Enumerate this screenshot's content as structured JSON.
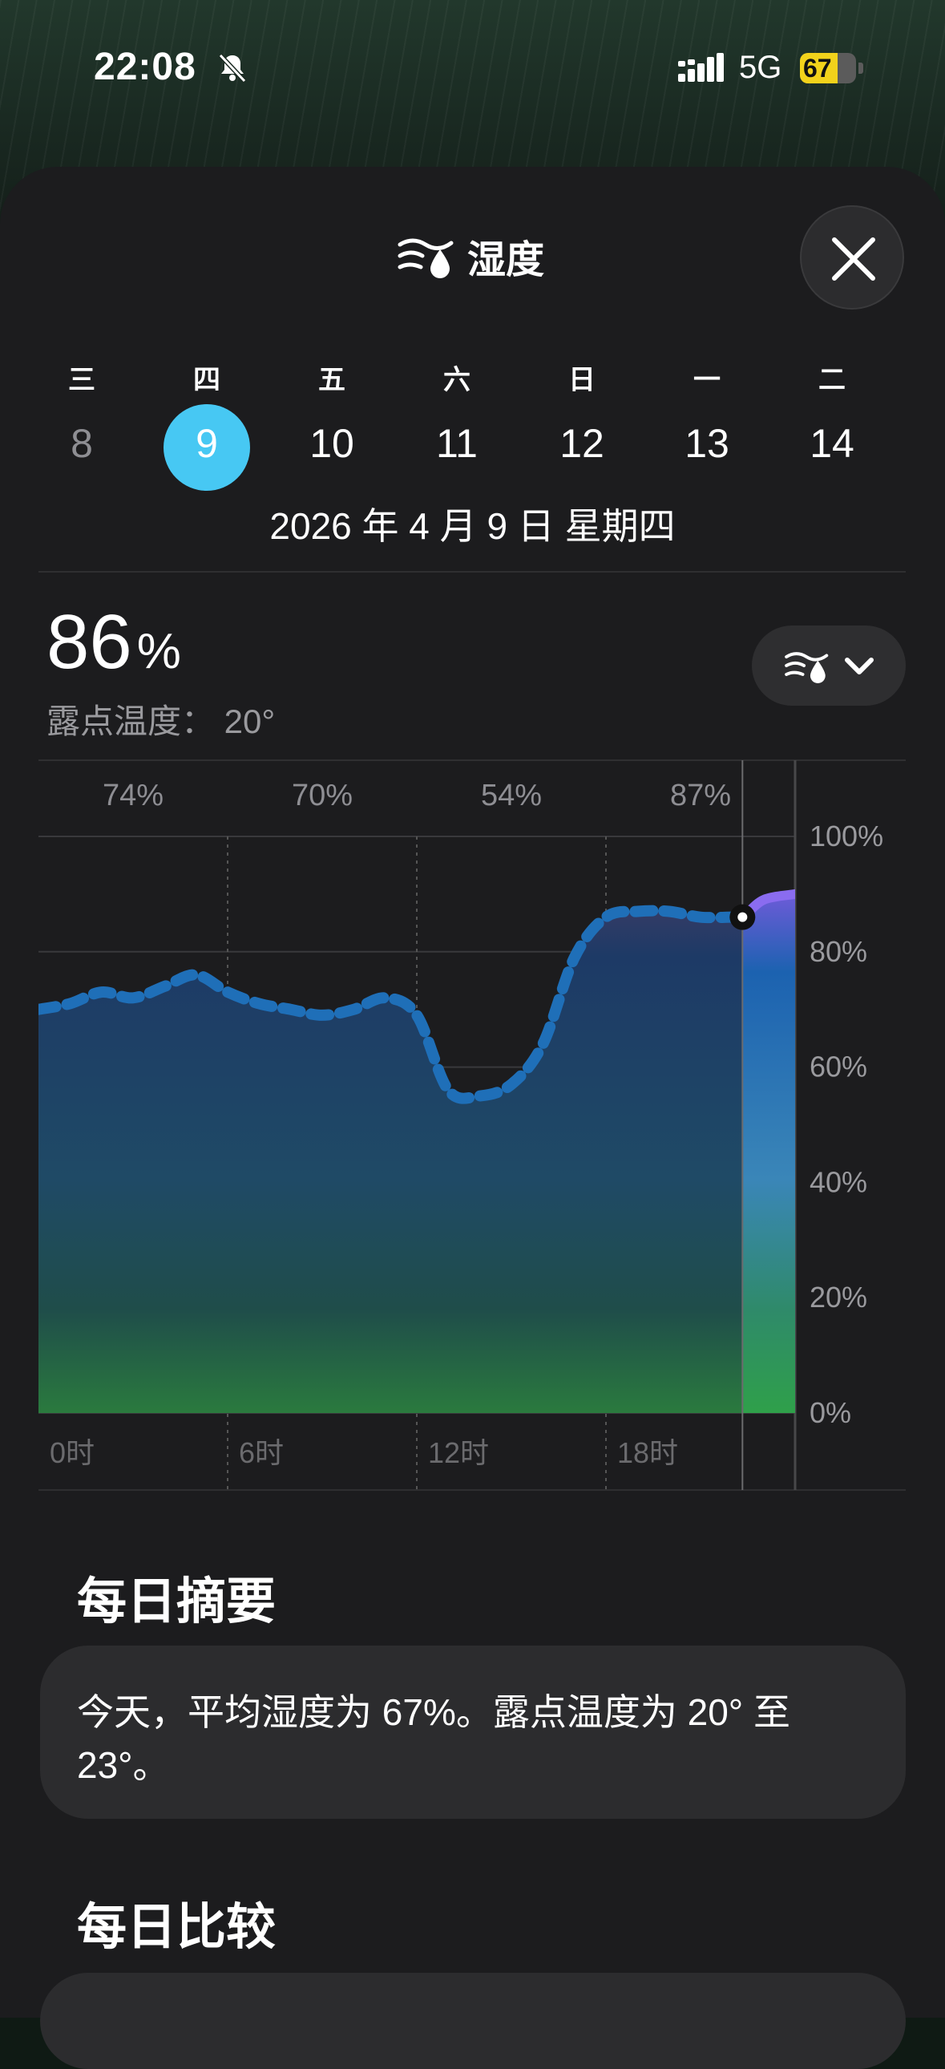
{
  "status_bar": {
    "time": "22:08",
    "network": "5G",
    "battery": "67",
    "battery_level": 0.67
  },
  "header": {
    "title": "湿度"
  },
  "calendar": {
    "weekdays": [
      "三",
      "四",
      "五",
      "六",
      "日",
      "一",
      "二"
    ],
    "days": [
      "8",
      "9",
      "10",
      "11",
      "12",
      "13",
      "14"
    ],
    "selected_index": 1,
    "date_label": "2026 年 4 月 9 日 星期四"
  },
  "current": {
    "value": "86",
    "unit": "%",
    "dew_point": "露点温度： 20°"
  },
  "chart_data": {
    "type": "area",
    "x_tick_labels": [
      "0时",
      "6时",
      "12时",
      "18时"
    ],
    "y_tick_labels": [
      "100%",
      "80%",
      "60%",
      "40%",
      "20%",
      "0%"
    ],
    "ylim": [
      0,
      100
    ],
    "xlim": [
      0,
      24
    ],
    "period_labels": [
      "74%",
      "70%",
      "54%",
      "87%"
    ],
    "series": [
      {
        "x": [
          0,
          1,
          2,
          3,
          4,
          5,
          6,
          7,
          8,
          9,
          10,
          11,
          12,
          13,
          14,
          15,
          16,
          17,
          18,
          19,
          20,
          21,
          22,
          22.33,
          23,
          24
        ],
        "values": [
          70,
          71,
          73,
          72,
          74,
          76,
          73,
          71,
          70,
          69,
          70,
          72,
          69,
          56,
          55,
          57,
          64,
          79,
          86,
          87,
          87,
          86,
          86,
          86,
          89,
          90
        ]
      }
    ],
    "current_hour": 22.33,
    "current_value": 86,
    "grid": true
  },
  "summary": {
    "heading": "每日摘要",
    "text": "今天，平均湿度为 67%。露点温度为 20° 至 23°。"
  },
  "comparison": {
    "heading": "每日比较"
  }
}
